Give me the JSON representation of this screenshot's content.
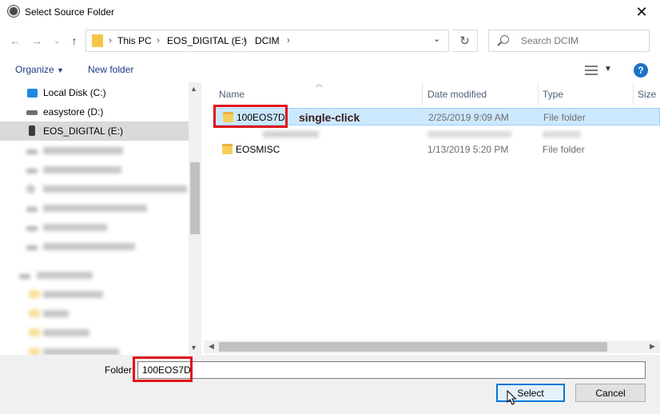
{
  "window": {
    "title": "Select Source Folder"
  },
  "nav": {
    "breadcrumbs": [
      "This PC",
      "EOS_DIGITAL (E:)",
      "DCIM"
    ],
    "search_placeholder": "Search DCIM"
  },
  "toolbar": {
    "organize": "Organize",
    "new_folder": "New folder"
  },
  "sidebar": {
    "items": [
      {
        "label": "Local Disk (C:)",
        "icon": "drive-icon",
        "selected": false
      },
      {
        "label": "easystore (D:)",
        "icon": "drive-icon",
        "selected": false
      },
      {
        "label": "EOS_DIGITAL (E:)",
        "icon": "sd-card-icon",
        "selected": true
      }
    ]
  },
  "columns": {
    "name": "Name",
    "date": "Date modified",
    "type": "Type",
    "size": "Size"
  },
  "files": [
    {
      "name": "100EOS7D",
      "date": "2/25/2019 9:09 AM",
      "type": "File folder",
      "selected": true
    },
    {
      "name": "EOSMISC",
      "date": "1/13/2019 5:20 PM",
      "type": "File folder",
      "selected": false
    }
  ],
  "annotation": {
    "text": "single-click"
  },
  "footer": {
    "folder_label": "Folder:",
    "folder_value": "100EOS7D",
    "select_label": "Select",
    "cancel_label": "Cancel"
  },
  "colors": {
    "highlight": "#e0101a",
    "selection": "#cce8ff",
    "link": "#1e3a8a"
  }
}
